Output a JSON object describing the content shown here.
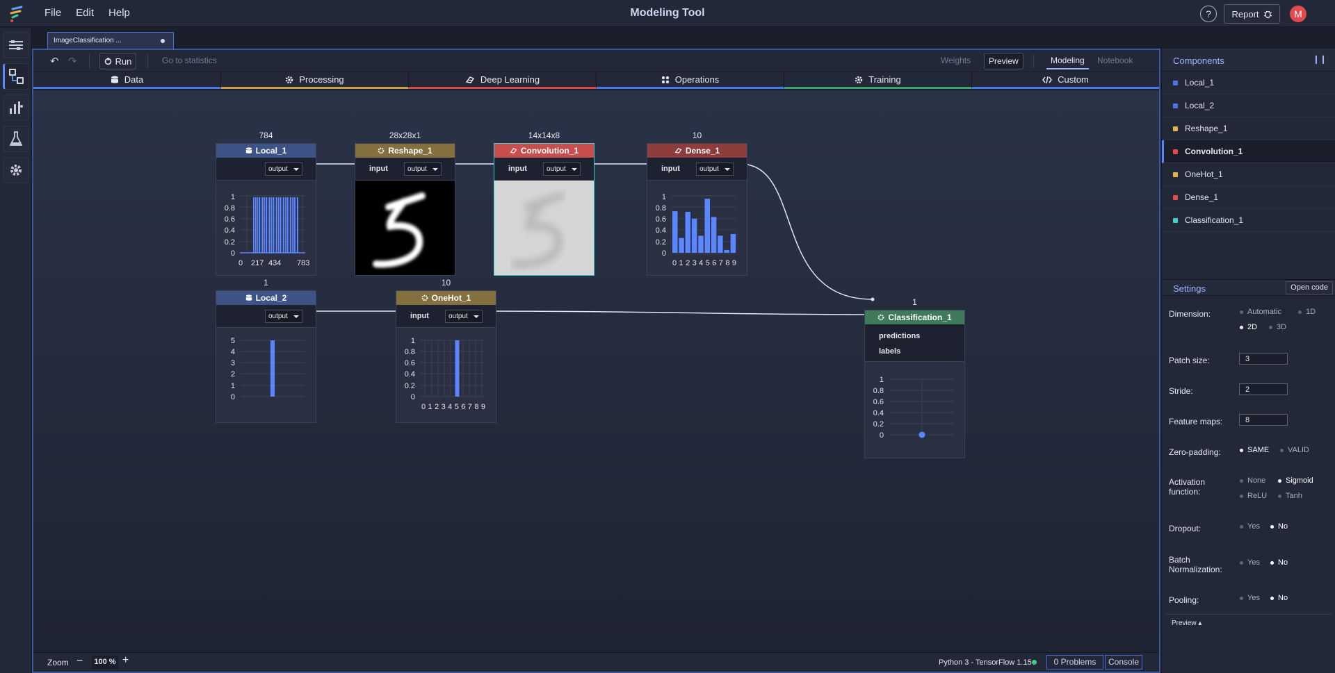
{
  "app": {
    "title": "Modeling Tool",
    "menu": [
      "File",
      "Edit",
      "Help"
    ],
    "report_label": "Report",
    "help_label": "?",
    "avatar_initial": "M"
  },
  "document_tab": {
    "label": "ImageClassification ..."
  },
  "toolbar": {
    "run_label": "Run",
    "goto_label": "Go to statistics",
    "weights_label": "Weights",
    "preview_label": "Preview",
    "modeling_label": "Modeling",
    "notebook_label": "Notebook"
  },
  "categories": [
    {
      "label": "Data",
      "icon": "database-icon",
      "color": "#4a78e0"
    },
    {
      "label": "Processing",
      "icon": "gear-icon",
      "color": "#c8a04a"
    },
    {
      "label": "Deep Learning",
      "icon": "brain-icon",
      "color": "#d94848"
    },
    {
      "label": "Operations",
      "icon": "operations-icon",
      "color": "#4a78e0"
    },
    {
      "label": "Training",
      "icon": "gear-icon",
      "color": "#3fa070"
    },
    {
      "label": "Custom",
      "icon": "code-icon",
      "color": "#4a78e0"
    }
  ],
  "nodes": {
    "local_1": {
      "title": "Local_1",
      "shape": "784",
      "output": "output",
      "yticks": [
        "1",
        "0.8",
        "0.6",
        "0.4",
        "0.2",
        "0"
      ],
      "xticks": [
        "0",
        "217",
        "434",
        "783"
      ]
    },
    "reshape_1": {
      "title": "Reshape_1",
      "shape": "28x28x1",
      "input": "input",
      "output": "output"
    },
    "convolution_1": {
      "title": "Convolution_1",
      "shape": "14x14x8",
      "input": "input",
      "output": "output"
    },
    "dense_1": {
      "title": "Dense_1",
      "shape": "10",
      "input": "input",
      "output": "output",
      "yticks": [
        "1",
        "0.8",
        "0.6",
        "0.4",
        "0.2",
        "0"
      ],
      "xticks": "0123456789",
      "values": [
        0.73,
        0.26,
        0.72,
        0.6,
        0.3,
        0.95,
        0.63,
        0.3,
        0.05,
        0.33
      ]
    },
    "local_2": {
      "title": "Local_2",
      "shape": "1",
      "output": "output",
      "yticks": [
        "5",
        "4",
        "3",
        "2",
        "1",
        "0"
      ],
      "value": 5
    },
    "onehot_1": {
      "title": "OneHot_1",
      "shape": "10",
      "input": "input",
      "output": "output",
      "yticks": [
        "1",
        "0.8",
        "0.6",
        "0.4",
        "0.2",
        "0"
      ],
      "xticks": "0123456789",
      "values": [
        0,
        0,
        0,
        0,
        0,
        1,
        0,
        0,
        0,
        0
      ]
    },
    "classification_1": {
      "title": "Classification_1",
      "shape": "1",
      "predictions": "predictions",
      "labels": "labels",
      "yticks": [
        "1",
        "0.8",
        "0.6",
        "0.4",
        "0.2",
        "0"
      ],
      "value": 0
    }
  },
  "components": {
    "title": "Components",
    "items": [
      {
        "label": "Local_1",
        "color": "#4a78e0"
      },
      {
        "label": "Local_2",
        "color": "#4a78e0"
      },
      {
        "label": "Reshape_1",
        "color": "#e3b34a"
      },
      {
        "label": "Convolution_1",
        "color": "#e34a4a"
      },
      {
        "label": "OneHot_1",
        "color": "#e3b34a"
      },
      {
        "label": "Dense_1",
        "color": "#e34a4a"
      },
      {
        "label": "Classification_1",
        "color": "#3ed0d0"
      }
    ]
  },
  "settings": {
    "title": "Settings",
    "open_code": "Open code",
    "dimension": {
      "label": "Dimension:",
      "options": [
        "Automatic",
        "1D",
        "2D",
        "3D"
      ],
      "selected": "2D"
    },
    "patch_size": {
      "label": "Patch size:",
      "value": "3"
    },
    "stride": {
      "label": "Stride:",
      "value": "2"
    },
    "feature_maps": {
      "label": "Feature maps:",
      "value": "8"
    },
    "zero_padding": {
      "label": "Zero-padding:",
      "options": [
        "SAME",
        "VALID"
      ],
      "selected": "SAME"
    },
    "activation": {
      "label1": "Activation",
      "label2": "function:",
      "options": [
        "None",
        "Sigmoid",
        "ReLU",
        "Tanh"
      ],
      "selected": "Sigmoid"
    },
    "dropout": {
      "label": "Dropout:",
      "options": [
        "Yes",
        "No"
      ],
      "selected": "No"
    },
    "batch_norm": {
      "label1": "Batch",
      "label2": "Normalization:",
      "options": [
        "Yes",
        "No"
      ],
      "selected": "No"
    },
    "pooling": {
      "label": "Pooling:",
      "options": [
        "Yes",
        "No"
      ],
      "selected": "No"
    },
    "preview_label": "Preview"
  },
  "bottom": {
    "zoom_label": "Zoom",
    "zoom_value": "100 %",
    "runtime": "Python 3 - TensorFlow 1.15",
    "problems": "0 Problems",
    "console": "Console"
  },
  "colors": {
    "data": "#3d5287",
    "processing": "#84703f",
    "deep_learning": "#c94e4e",
    "dense": "#8f3c3c",
    "training": "#3f7a5a",
    "accent": "#5a86ff"
  }
}
